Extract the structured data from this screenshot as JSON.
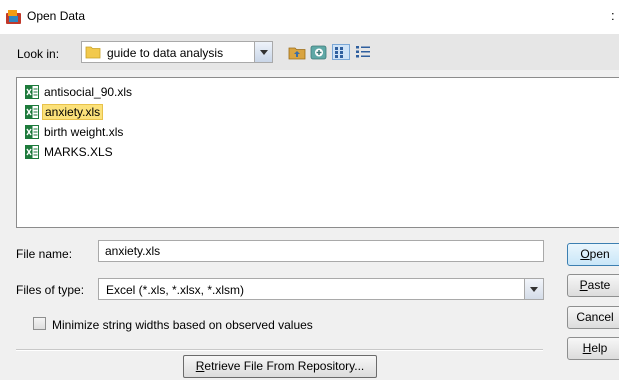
{
  "window": {
    "title": "Open Data",
    "close_glyph": ":"
  },
  "look_in": {
    "label": "Look in:",
    "value": "guide to data analysis"
  },
  "toolbar_icons": [
    "up-folder-icon",
    "create-new-folder-icon",
    "list-view-icon",
    "details-view-icon"
  ],
  "files": [
    {
      "name": "antisocial_90.xls",
      "selected": false
    },
    {
      "name": "anxiety.xls",
      "selected": true
    },
    {
      "name": "birth weight.xls",
      "selected": false
    },
    {
      "name": "MARKS.XLS",
      "selected": false
    }
  ],
  "file_name": {
    "label": "File name:",
    "value": "anxiety.xls"
  },
  "files_of_type": {
    "label": "Files of type:",
    "value": "Excel (*.xls, *.xlsx, *.xlsm)"
  },
  "minimize_option": {
    "label": "Minimize string widths based on observed values",
    "checked": false
  },
  "buttons": {
    "open": {
      "mnemonic": "O",
      "rest": "pen"
    },
    "paste": {
      "mnemonic": "P",
      "rest": "aste"
    },
    "cancel": {
      "label": "Cancel"
    },
    "help": {
      "mnemonic": "H",
      "rest": "elp"
    },
    "retrieve": {
      "mnemonic": "R",
      "rest": "etrieve File From Repository..."
    }
  },
  "colors": {
    "selection_bg": "#fbe17a",
    "excel_green": "#1e7a3c",
    "dialog_bg": "#f0f0f0"
  }
}
